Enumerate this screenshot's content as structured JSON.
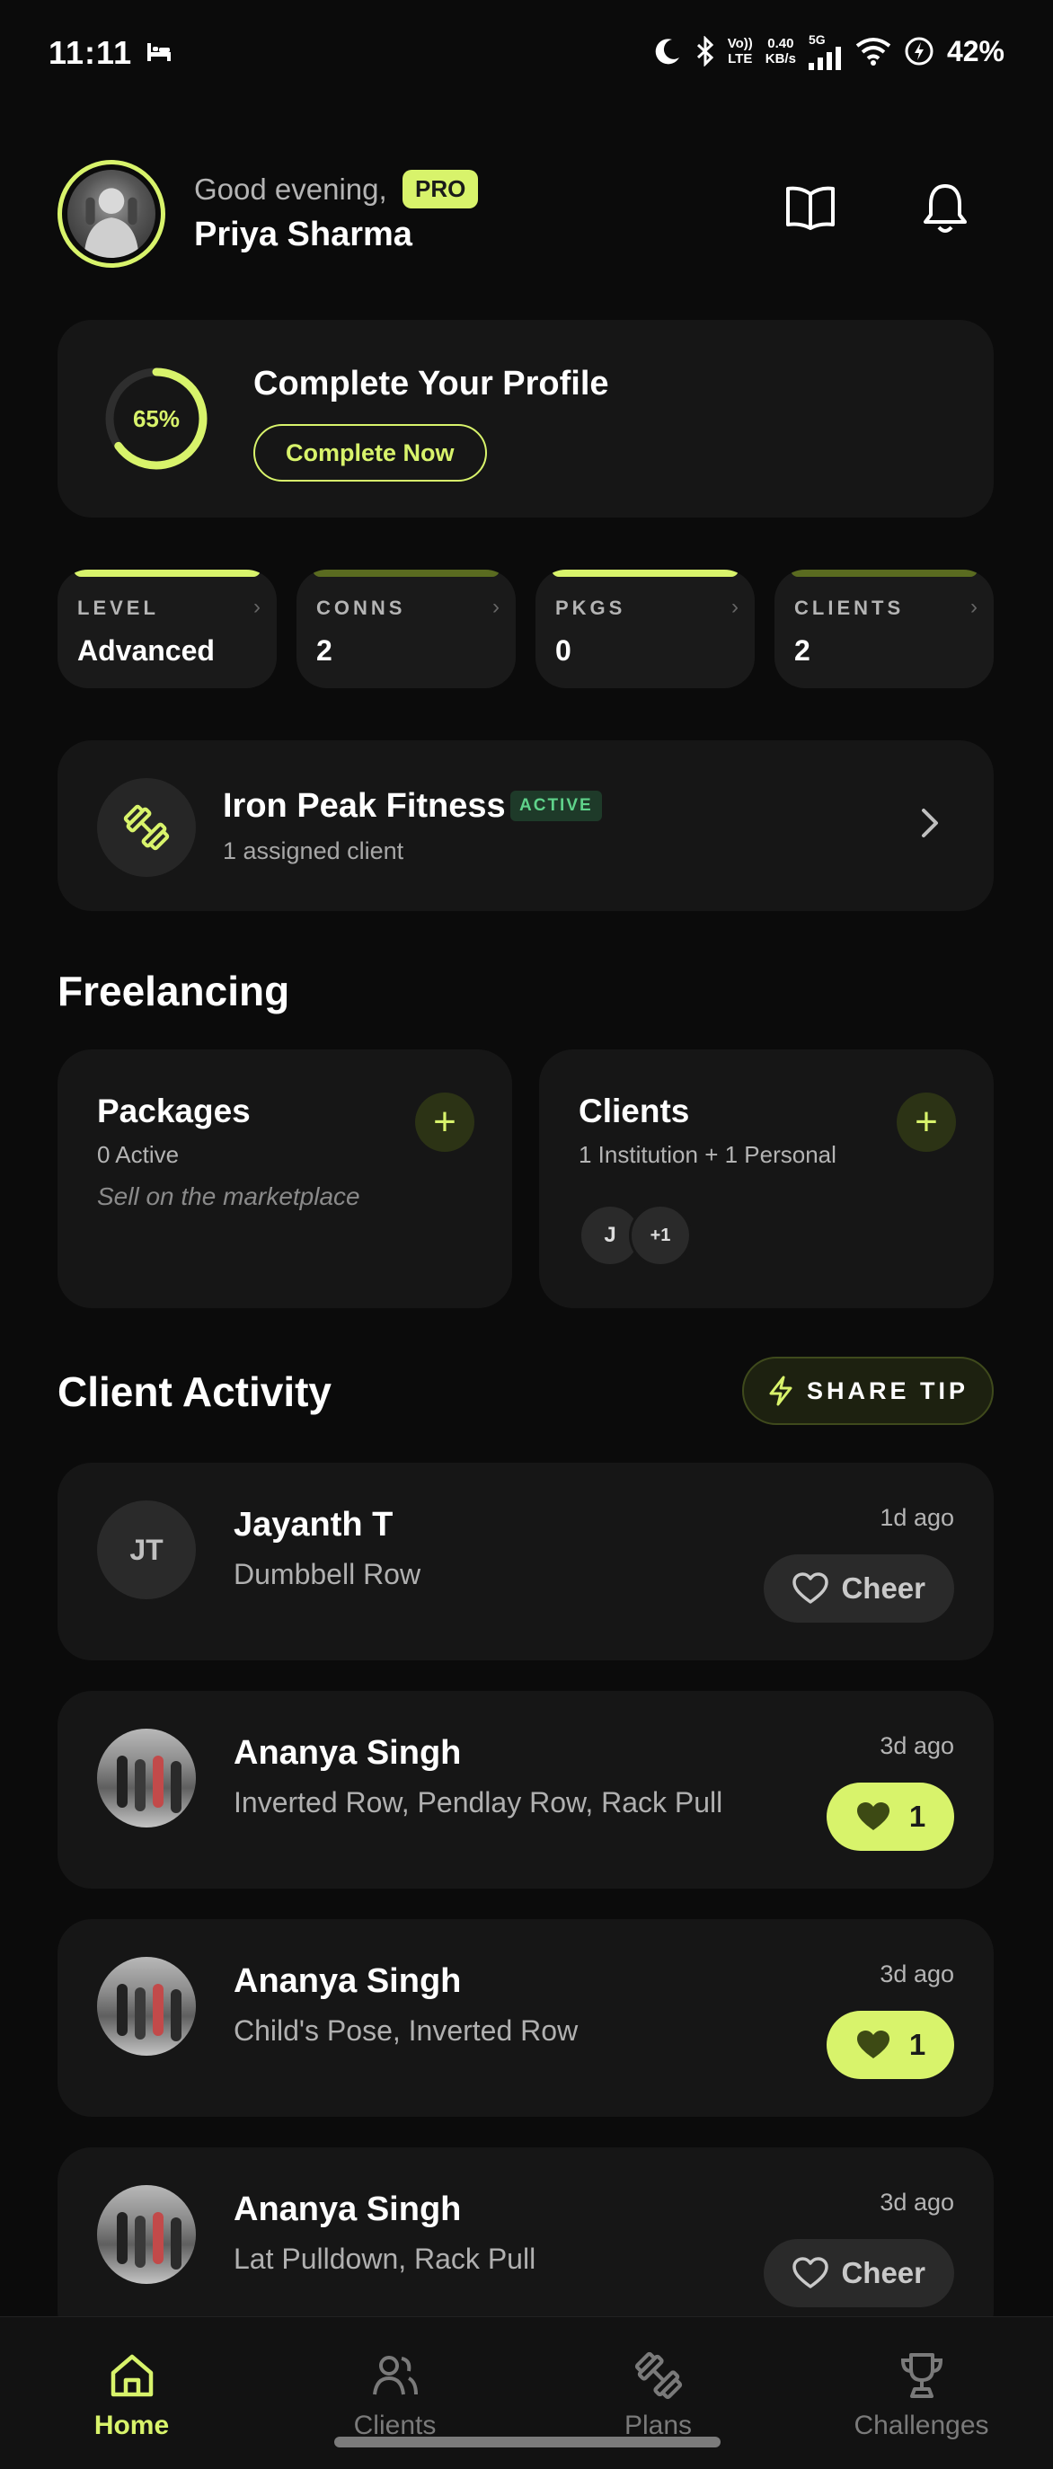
{
  "status_bar": {
    "time": "11:11",
    "net_speed_top": "0.40",
    "net_speed_bottom": "KB/s",
    "lte_top": "Vo))",
    "lte_bottom": "LTE",
    "signal_label": "5G",
    "battery": "42%"
  },
  "header": {
    "greeting": "Good evening,",
    "badge": "PRO",
    "name": "Priya Sharma",
    "icons": [
      "book-icon",
      "bell-icon"
    ]
  },
  "profile": {
    "percent_label": "65%",
    "progress": 0.65,
    "title": "Complete Your Profile",
    "button": "Complete Now"
  },
  "stats": [
    {
      "label": "LEVEL",
      "value": "Advanced",
      "bar_color": "#d8f36b"
    },
    {
      "label": "CONNS",
      "value": "2",
      "bar_color": "#5a6b20"
    },
    {
      "label": "PKGS",
      "value": "0",
      "bar_color": "#d8f36b"
    },
    {
      "label": "CLIENTS",
      "value": "2",
      "bar_color": "#5a6b20"
    }
  ],
  "stat_chevron": "›",
  "gym": {
    "name": "Iron Peak Fitness",
    "badge": "ACTIVE",
    "subtitle": "1 assigned client"
  },
  "freelancing": {
    "title": "Freelancing",
    "packages": {
      "title": "Packages",
      "subtitle": "0 Active",
      "note": "Sell on the marketplace",
      "plus": "+"
    },
    "clients": {
      "title": "Clients",
      "subtitle": "1 Institution + 1 Personal",
      "plus": "+",
      "avatar_initial": "J",
      "avatar_more": "+1"
    }
  },
  "activity": {
    "title": "Client Activity",
    "share_button": "SHARE TIP",
    "items": [
      {
        "initials": "JT",
        "name": "Jayanth T",
        "exercises": "Dumbbell Row",
        "time": "1d ago",
        "action": "Cheer",
        "liked": false
      },
      {
        "initials": "",
        "name": "Ananya Singh",
        "exercises": "Inverted Row, Pendlay Row, Rack Pull",
        "time": "3d ago",
        "action": "1",
        "liked": true
      },
      {
        "initials": "",
        "name": "Ananya Singh",
        "exercises": "Child's Pose, Inverted Row",
        "time": "3d ago",
        "action": "1",
        "liked": true
      },
      {
        "initials": "",
        "name": "Ananya Singh",
        "exercises": "Lat Pulldown, Rack Pull",
        "time": "3d ago",
        "action": "Cheer",
        "liked": false
      }
    ]
  },
  "nav": {
    "items": [
      {
        "label": "Home",
        "icon": "home-icon",
        "active": true
      },
      {
        "label": "Clients",
        "icon": "users-icon",
        "active": false
      },
      {
        "label": "Plans",
        "icon": "dumbbell-icon",
        "active": false
      },
      {
        "label": "Challenges",
        "icon": "trophy-icon",
        "active": false
      }
    ]
  },
  "colors": {
    "accent": "#d8f36b",
    "background": "#0b0b0b",
    "card": "#161616",
    "active_badge": "#5fd28a"
  }
}
